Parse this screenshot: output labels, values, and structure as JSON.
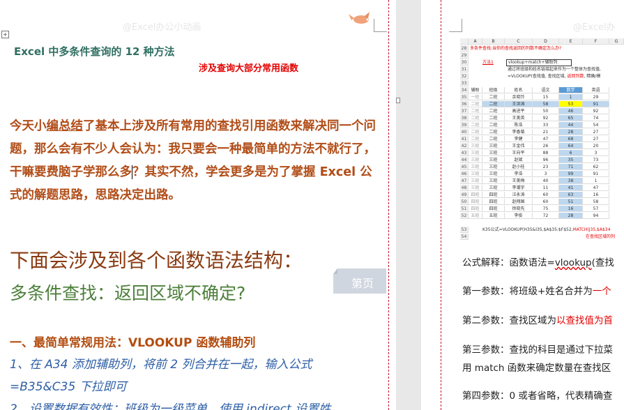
{
  "left": {
    "watermark": "@Excel办公小动画",
    "title": "Excel 中多条件查询的 12 种方法",
    "subtitle": "涉及查询大部分常用函数",
    "intro_parts": [
      "今天小",
      "编总结",
      "了基本上涉及所有常用的查找引用函数来解决同一个问题，那么会有不少人会认为：我只要会一种最简单的方法不就行了，干嘛要费脑子学那么多",
      "？其实不然，学会更多是为了掌握 Excel 公式的解题思路，思路决定出路。"
    ],
    "heading1": "下面会涉及到各个函数语法结构：",
    "heading2": "多条件查找：返回区域不确定?",
    "button_label": "第页",
    "section1": "一、最简单常规用法：VLOOKUP 函数辅助列",
    "step1_line1": "1、在 A34 添加辅助列，将前 2 列合并在一起，输入公式",
    "step1_line2": "=B35&C35 下拉即可",
    "step2_line": "2、设置数据有效性：班级为一级菜单，使用 indirect 设置姓"
  },
  "right": {
    "watermark": "@Excel办",
    "sheet": {
      "col_headers": [
        "A",
        "B",
        "C",
        "D",
        "E",
        "F",
        "G"
      ],
      "row28_text": "多条件查找:当你的查找返回的列数不确定怎么办?",
      "row30_label": "方法1",
      "row30_text": "vlookup+match+辅助列",
      "row31_text": "通过将班级和姓名链接起来作为一个整体为查找值,",
      "row32_text": "=VLOOKUP(查找值, 查找区域, ",
      "row32_red": "返回列数",
      "row32_tail": ", 精确/模",
      "header": [
        "辅助",
        "班级",
        "姓名",
        "语文",
        "数学",
        "英语"
      ],
      "rows": [
        {
          "n": "35",
          "cells": [
            "一班",
            "二班",
            "余晓玲",
            "15",
            "1",
            "29"
          ]
        },
        {
          "n": "36",
          "cells": [
            "二班",
            "二班",
            "王洪涛",
            "58",
            "53",
            "91"
          ]
        },
        {
          "n": "37",
          "cells": [
            "二班",
            "二班",
            "高进平",
            "50",
            "46",
            "92"
          ]
        },
        {
          "n": "38",
          "cells": [
            "二班",
            "二班",
            "王美英",
            "92",
            "65",
            "74"
          ]
        },
        {
          "n": "39",
          "cells": [
            "二班",
            "二班",
            "陈浩",
            "33",
            "44",
            "54"
          ]
        },
        {
          "n": "40",
          "cells": [
            "二班",
            "二班",
            "李香菊",
            "21",
            "28",
            "27"
          ]
        },
        {
          "n": "41",
          "cells": [
            "二班",
            "二班",
            "李健",
            "47",
            "68",
            "27"
          ]
        },
        {
          "n": "42",
          "cells": [
            "三班",
            "三班",
            "王金伟",
            "26",
            "64",
            "20"
          ]
        },
        {
          "n": "43",
          "cells": [
            "三班",
            "三班",
            "王向平",
            "88",
            "6",
            "3"
          ]
        },
        {
          "n": "44",
          "cells": [
            "三班",
            "三班",
            "赵斌",
            "96",
            "35",
            "73"
          ]
        },
        {
          "n": "45",
          "cells": [
            "三班",
            "三班",
            "赵小桂",
            "23",
            "71",
            "62"
          ]
        },
        {
          "n": "46",
          "cells": [
            "三班",
            "三班",
            "李浩",
            "3",
            "99",
            "91"
          ]
        },
        {
          "n": "47",
          "cells": [
            "三班",
            "三班",
            "王美梅",
            "40",
            "38",
            "1"
          ]
        },
        {
          "n": "48",
          "cells": [
            "三班",
            "三班",
            "李潮宇",
            "11",
            "41",
            "47"
          ]
        },
        {
          "n": "49",
          "cells": [
            "四班",
            "四班",
            "汪永涛",
            "60",
            "63",
            "16"
          ]
        },
        {
          "n": "50",
          "cells": [
            "四班",
            "四班",
            "赵翔国",
            "60",
            "51",
            "58"
          ]
        },
        {
          "n": "51",
          "cells": [
            "四班",
            "四班",
            "徐晓先",
            "75",
            "16",
            "57"
          ]
        },
        {
          "n": "52",
          "cells": [
            "五班",
            "五班",
            "李俊",
            "72",
            "28",
            "94"
          ]
        }
      ],
      "row53_text": "K35公式=VLOOKUP(H35&I35,$A$35:$F$52,",
      "row53_red": "MATCH(J35,$A$34",
      "row54_red": "在查找区域的列"
    },
    "lines": [
      {
        "pre": "公式解释：函数语法=",
        "link": "vlookup",
        "post": "(查找"
      },
      {
        "pre": "第一参数：将班级+姓名合并为",
        "red": "一个"
      },
      {
        "pre": "第二参数：查找区域为",
        "red": "以查找值为首"
      },
      {
        "pre": "第三参数：查找的科目是通过下拉菜"
      },
      {
        "pre": "用 match 函数来确定数量在查找区"
      },
      {
        "pre": "第四参数：0 或者省略，代表精确查"
      }
    ]
  }
}
